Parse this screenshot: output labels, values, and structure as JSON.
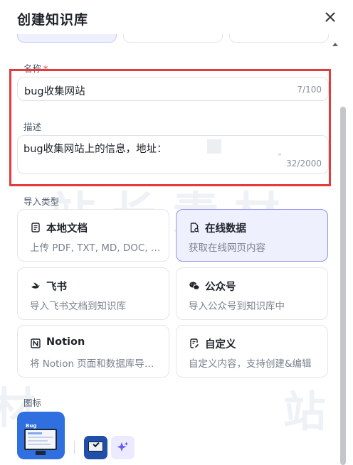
{
  "dialog": {
    "title": "创建知识库"
  },
  "form": {
    "name": {
      "label": "名称",
      "required_mark": "*",
      "value": "bug收集网站",
      "counter": "7/100"
    },
    "description": {
      "label": "描述",
      "value": "bug收集网站上的信息，地址：",
      "counter": "32/2000"
    },
    "import_type": {
      "label": "导入类型",
      "options": [
        {
          "title": "本地文档",
          "desc": "上传 PDF, TXT, MD, DOC, DOCX 格式的本地文件",
          "icon": "document-icon",
          "selected": false
        },
        {
          "title": "在线数据",
          "desc": "获取在线网页内容",
          "icon": "web-page-icon",
          "selected": true
        },
        {
          "title": "飞书",
          "desc": "导入飞书文档到知识库",
          "icon": "feishu-icon",
          "selected": false
        },
        {
          "title": "公众号",
          "desc": "导入公众号到知识库中",
          "icon": "wechat-icon",
          "selected": false
        },
        {
          "title": "Notion",
          "desc": "将 Notion 页面和数据库导入到知识库",
          "icon": "notion-icon",
          "selected": false
        },
        {
          "title": "自定义",
          "desc": "自定义内容，支持创建&编辑",
          "icon": "edit-doc-icon",
          "selected": false
        }
      ]
    },
    "icon_section": {
      "label": "图标",
      "preview_text": "Bug"
    }
  },
  "colors": {
    "accent": "#8f95ee",
    "selected_bg": "#eef0fd",
    "highlight": "#e5393a",
    "required": "#e83a3a",
    "icon_bg": "#2f6fe0"
  }
}
